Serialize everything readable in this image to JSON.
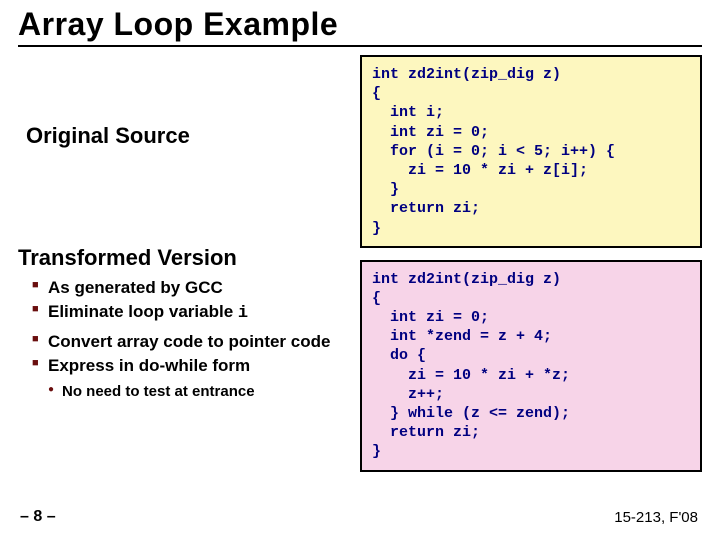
{
  "title": "Array Loop Example",
  "left": {
    "original_heading": "Original Source",
    "transformed_heading": "Transformed Version",
    "bullets": [
      "As generated by GCC",
      "Eliminate loop variable ",
      "Convert array code to pointer code",
      "Express in do-while form"
    ],
    "bullet_i_token": "i",
    "sub_bullet": "No need to test at entrance"
  },
  "code1": "int zd2int(zip_dig z)\n{\n  int i;\n  int zi = 0;\n  for (i = 0; i < 5; i++) {\n    zi = 10 * zi + z[i];\n  }\n  return zi;\n}",
  "code2": "int zd2int(zip_dig z)\n{\n  int zi = 0;\n  int *zend = z + 4;\n  do {\n    zi = 10 * zi + *z;\n    z++;\n  } while (z <= zend);\n  return zi;\n}",
  "footer": {
    "left": "– 8 –",
    "right": "15-213, F'08"
  }
}
